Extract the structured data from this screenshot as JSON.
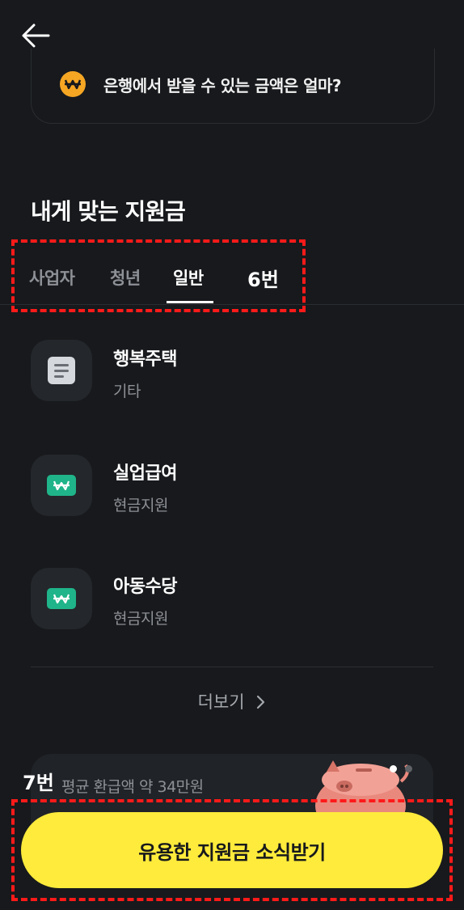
{
  "header": {
    "back_icon": "arrow-left-icon"
  },
  "bank_card": {
    "icon": "won-coin-icon",
    "text": "은행에서 받을 수 있는 금액은 얼마?",
    "icon_color": "#f5a623"
  },
  "section": {
    "title": "내게 맞는 지원금"
  },
  "tabs": [
    {
      "label": "사업자",
      "active": false
    },
    {
      "label": "청년",
      "active": false
    },
    {
      "label": "일반",
      "active": true
    }
  ],
  "annotations": {
    "tabs_label": "6번",
    "cta_label": "7번",
    "color": "#ff1a1a"
  },
  "items": [
    {
      "title": "행복주택",
      "category": "기타",
      "icon": "document-icon"
    },
    {
      "title": "실업급여",
      "category": "현금지원",
      "icon": "won-bill-icon"
    },
    {
      "title": "아동수당",
      "category": "현금지원",
      "icon": "won-bill-icon"
    }
  ],
  "more": {
    "label": "더보기",
    "icon": "chevron-right-icon"
  },
  "refund_card": {
    "text": "평균 환급액 약 34만원",
    "image": "piggy-bank-icon"
  },
  "cta": {
    "label": "유용한 지원금 소식받기",
    "color": "#ffeb3b"
  }
}
